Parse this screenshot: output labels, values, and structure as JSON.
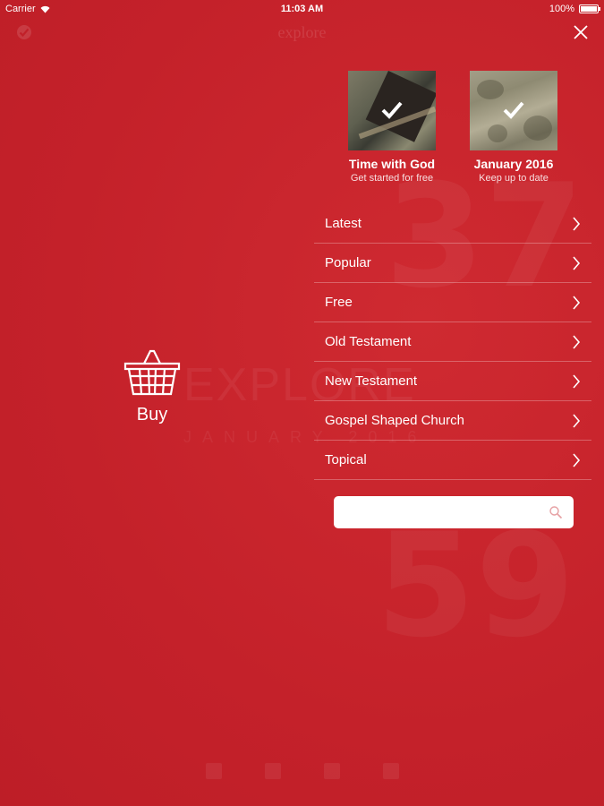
{
  "status_bar": {
    "carrier": "Carrier",
    "time": "11:03 AM",
    "battery": "100%",
    "battery_level": 1.0
  },
  "nav": {
    "title": "explore",
    "close_icon": "close-icon",
    "logo_icon": "check-logo-icon"
  },
  "background": {
    "number_top": "37",
    "number_bottom": "59",
    "brand_word": "EXPLORE",
    "month_word": "JANUARY 2016"
  },
  "buy": {
    "icon": "basket-icon",
    "label": "Buy"
  },
  "featured": [
    {
      "title": "Time with God",
      "subtitle": "Get started for free",
      "badge_icon": "check-icon"
    },
    {
      "title": "January 2016",
      "subtitle": "Keep up to date",
      "badge_icon": "check-icon"
    }
  ],
  "menu": {
    "items": [
      {
        "label": "Latest"
      },
      {
        "label": "Popular"
      },
      {
        "label": "Free"
      },
      {
        "label": "Old Testament"
      },
      {
        "label": "New Testament"
      },
      {
        "label": "Gospel Shaped Church"
      },
      {
        "label": "Topical"
      }
    ],
    "chevron_icon": "chevron-right-icon"
  },
  "search": {
    "value": "",
    "placeholder": "",
    "icon": "search-icon"
  },
  "colors": {
    "background": "#c8222a",
    "text": "#ffffff",
    "divider": "rgba(255,255,255,0.28)"
  }
}
